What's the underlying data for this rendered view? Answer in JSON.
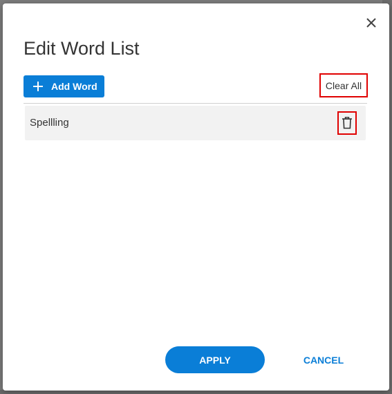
{
  "dialog": {
    "title": "Edit Word List",
    "close_icon": "close-icon"
  },
  "toolbar": {
    "add_label": "Add Word",
    "add_icon": "plus-icon",
    "clear_label": "Clear All"
  },
  "words": [
    {
      "text": "Spellling",
      "delete_icon": "trash-icon"
    }
  ],
  "footer": {
    "apply_label": "APPLY",
    "cancel_label": "CANCEL"
  },
  "colors": {
    "accent": "#0a7ed7",
    "highlight": "#e00000",
    "row_bg": "#f2f2f2"
  }
}
